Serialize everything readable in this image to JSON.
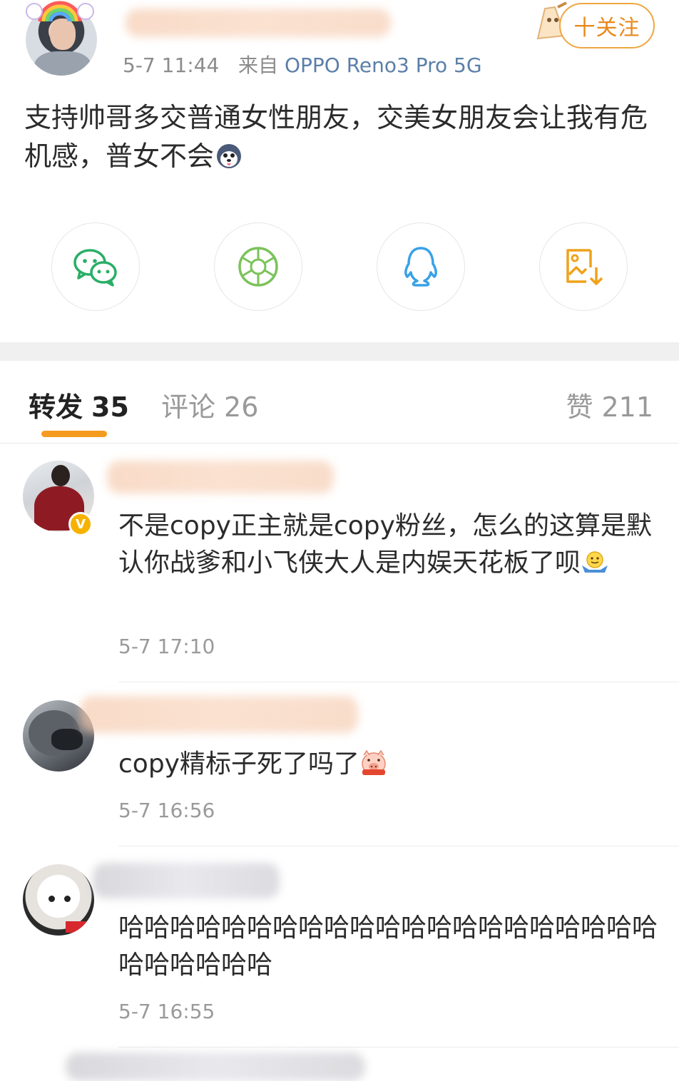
{
  "post": {
    "author_name": "",
    "timestamp": "5-7 11:44",
    "source_prefix": "来自",
    "device": "OPPO Reno3 Pro 5G",
    "follow_label": "十关注",
    "text": "支持帅哥多交普通女性朋友，交美女朋友会让我有危机感，普女不会"
  },
  "share": [
    {
      "name": "wechat",
      "icon": "wechat-icon",
      "color": "#2aae67"
    },
    {
      "name": "moments",
      "icon": "moments-aperture-icon",
      "color": "#7bc25a"
    },
    {
      "name": "qq",
      "icon": "qq-penguin-icon",
      "color": "#38a1e6"
    },
    {
      "name": "save-image",
      "icon": "save-image-icon",
      "color": "#f0a21a"
    }
  ],
  "tabs": {
    "repost_label": "转发",
    "repost_count": "35",
    "comments_label": "评论",
    "comments_count": "26",
    "likes_label": "赞",
    "likes_count": "211",
    "active": "repost",
    "accent": "#f59b1f"
  },
  "comments": [
    {
      "text": "不是copy正主就是copy粉丝，怎么的这算是默认你战爹和小飞侠大人是内娱天花板了呗",
      "time": "5-7 17:10",
      "emoji": "shrug-emoji",
      "verified": true
    },
    {
      "text": "copy精标子死了吗了",
      "time": "5-7 16:56",
      "emoji": "pig-emoji",
      "verified": false
    },
    {
      "text": "哈哈哈哈哈哈哈哈哈哈哈哈哈哈哈哈哈哈哈哈哈哈哈哈哈哈哈",
      "time": "5-7 16:55",
      "emoji": "",
      "verified": false
    }
  ]
}
